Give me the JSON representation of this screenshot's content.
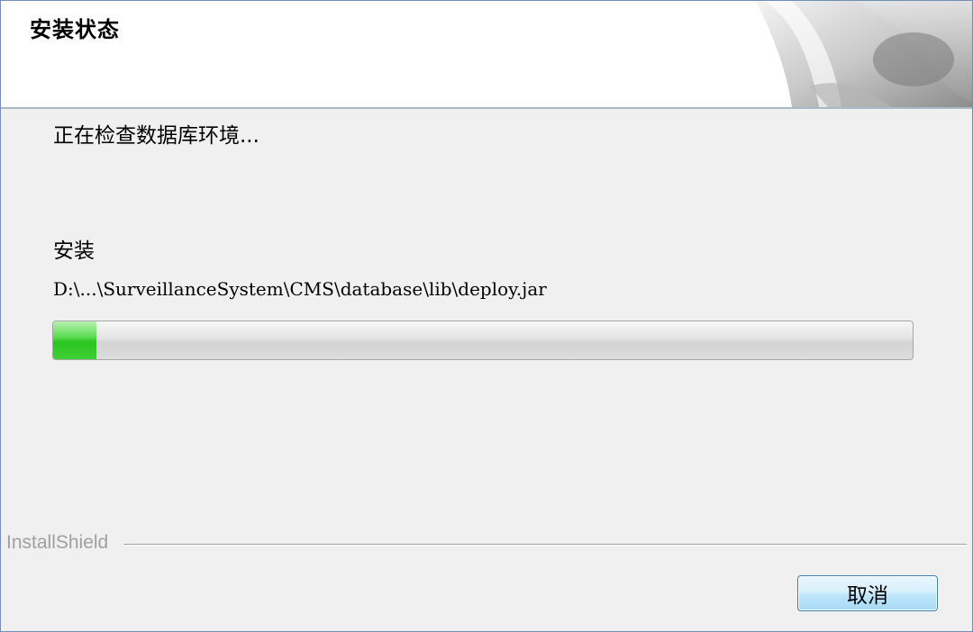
{
  "header": {
    "title": "安装状态",
    "graphic_icon": "installshield-header-graphic-icon"
  },
  "main": {
    "status_text": "正在检查数据库环境...",
    "section_label": "安装",
    "file_path": "D:\\...\\SurveillanceSystem\\CMS\\database\\lib\\deploy.jar",
    "progress_fraction": 0.05,
    "progress_color": "#29c521"
  },
  "footer": {
    "brand_label": "InstallShield",
    "cancel_label": "取消"
  },
  "colors": {
    "window_border": "#6d8fb8",
    "button_border": "#3c7fb1",
    "panel_background": "#f0f0f0"
  }
}
